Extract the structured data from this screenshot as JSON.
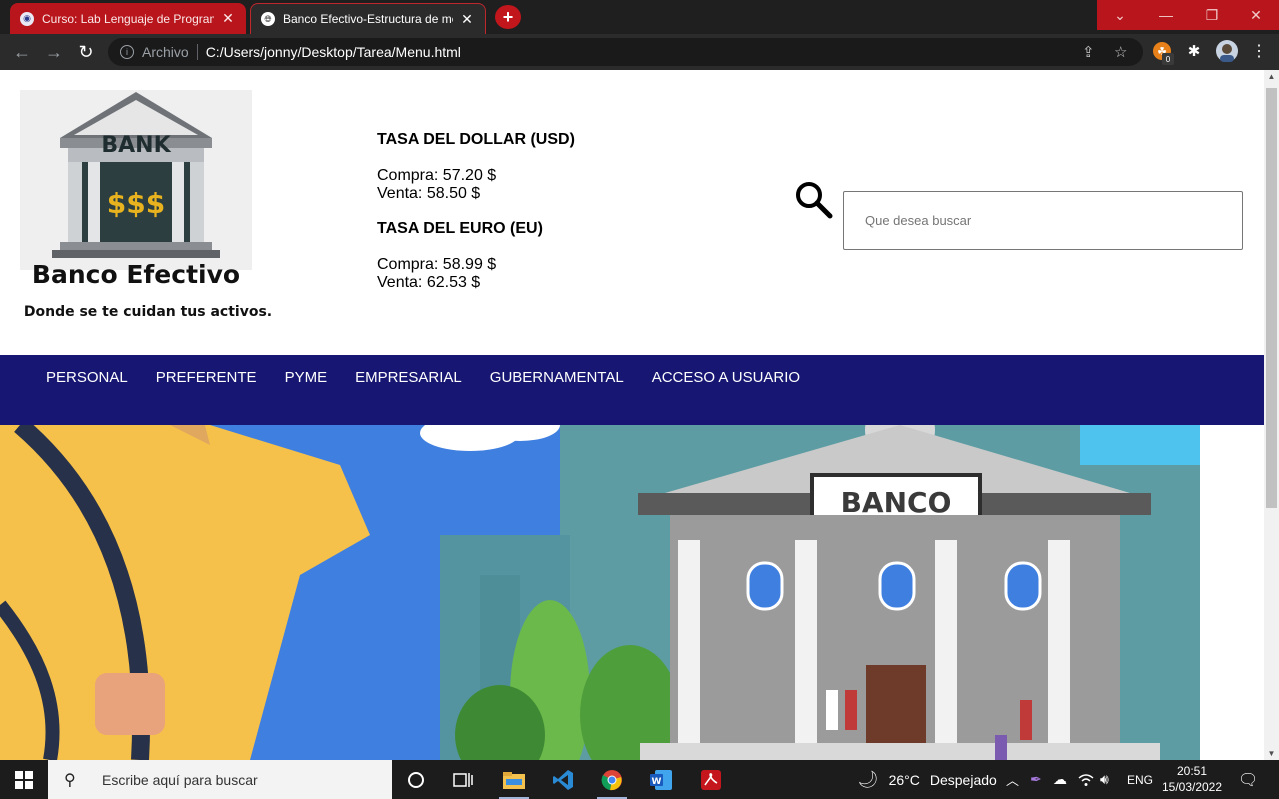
{
  "browser": {
    "tabs": [
      {
        "title": "Curso: Lab Lenguaje de Programación",
        "active": false
      },
      {
        "title": "Banco Efectivo-Estructura de menú",
        "active": true
      }
    ],
    "address": {
      "scheme_label": "Archivo",
      "url": "C:/Users/jonny/Desktop/Tarea/Menu.html"
    },
    "extension_badge": "0"
  },
  "page": {
    "logo": {
      "sign_text": "BANK",
      "money_text": "$$$",
      "name": "Banco Efectivo",
      "slogan": "Donde se te cuidan tus activos."
    },
    "rates": [
      {
        "title": "TASA DEL DOLLAR (USD)",
        "buy": "Compra: 57.20 $",
        "sell": "Venta: 58.50 $"
      },
      {
        "title": "TASA DEL EURO (EU)",
        "buy": "Compra: 58.99 $",
        "sell": "Venta: 62.53 $"
      }
    ],
    "search": {
      "placeholder": "Que desea buscar"
    },
    "nav": [
      "PERSONAL",
      "PREFERENTE",
      "PYME",
      "EMPRESARIAL",
      "GUBERNAMENTAL",
      "ACCESO A USUARIO"
    ],
    "banner": {
      "bank_sign": "BANCO"
    },
    "colors": {
      "nav_bg": "#171773",
      "tab_red": "#b8161c"
    }
  },
  "taskbar": {
    "search_placeholder": "Escribe aquí para buscar",
    "weather": {
      "temp": "26°C",
      "condition": "Despejado"
    },
    "language": "ENG",
    "time": "20:51",
    "date": "15/03/2022"
  }
}
